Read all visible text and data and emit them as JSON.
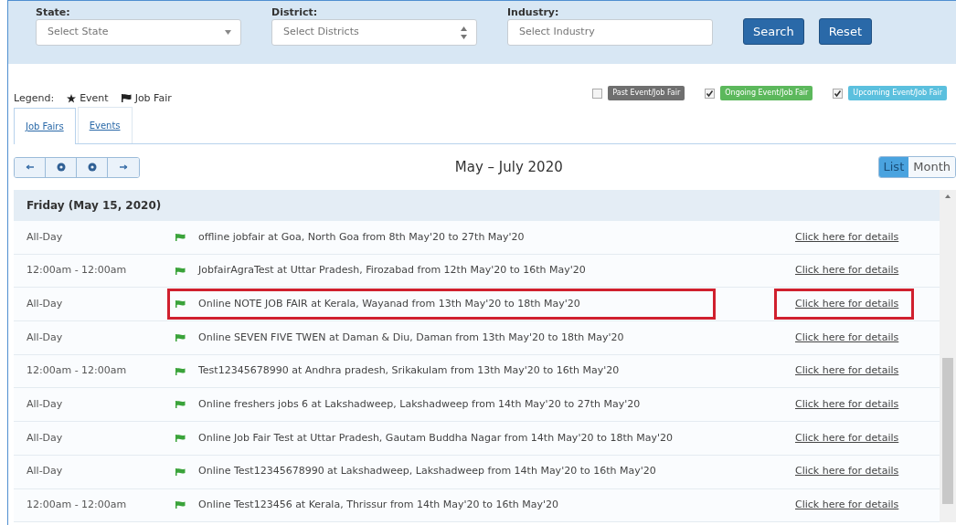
{
  "filters": [
    {
      "label": "State:",
      "kind": "select",
      "placeholder": "Select State"
    },
    {
      "label": "District:",
      "kind": "spinner",
      "placeholder": "Select Districts"
    },
    {
      "label": "Industry:",
      "kind": "text",
      "placeholder": "Select Industry"
    }
  ],
  "filter_buttons": [
    "Search",
    "Reset"
  ],
  "legend": {
    "label": "Legend:",
    "items": [
      {
        "kind": "star",
        "label": "Event"
      },
      {
        "kind": "flag",
        "label": "Job Fair"
      }
    ]
  },
  "status_filters": [
    {
      "label": "Past Event/Job Fair",
      "checked": false,
      "color": "#6f6f6f"
    },
    {
      "label": "Ongoing Event/Job Fair",
      "checked": true,
      "color": "#5cb85c"
    },
    {
      "label": "Upcoming Event/Job Fair",
      "checked": true,
      "color": "#5bc0de"
    }
  ],
  "tabs": [
    {
      "label": "Job Fairs",
      "selected": true
    },
    {
      "label": "Events",
      "selected": false
    }
  ],
  "calendar": {
    "title": "May – July 2020",
    "views": [
      {
        "label": "List",
        "selected": true
      },
      {
        "label": "Month",
        "selected": false
      }
    ],
    "day_header": "Friday (May 15, 2020)",
    "rows": [
      {
        "time": "All-Day",
        "title": "offline jobfair at Goa, North Goa from 8th May'20 to 27th May'20",
        "link": "Click here for details",
        "highlighted": false
      },
      {
        "time": "12:00am - 12:00am",
        "title": "JobfairAgraTest at Uttar Pradesh, Firozabad from 12th May'20 to 16th May'20",
        "link": "Click here for details",
        "highlighted": false
      },
      {
        "time": "All-Day",
        "title": "Online NOTE JOB FAIR at Kerala, Wayanad from 13th May'20 to 18th May'20",
        "link": "Click here for details",
        "highlighted": true
      },
      {
        "time": "All-Day",
        "title": "Online SEVEN FIVE TWEN at Daman & Diu, Daman from 13th May'20 to 18th May'20",
        "link": "Click here for details",
        "highlighted": false
      },
      {
        "time": "12:00am - 12:00am",
        "title": "Test12345678990 at Andhra pradesh, Srikakulam from 13th May'20 to 16th May'20",
        "link": "Click here for details",
        "highlighted": false
      },
      {
        "time": "All-Day",
        "title": "Online freshers jobs 6 at Lakshadweep, Lakshadweep from 14th May'20 to 27th May'20",
        "link": "Click here for details",
        "highlighted": false
      },
      {
        "time": "All-Day",
        "title": "Online Job Fair Test at Uttar Pradesh, Gautam Buddha Nagar from 14th May'20 to 18th May'20",
        "link": "Click here for details",
        "highlighted": false
      },
      {
        "time": "All-Day",
        "title": "Online Test12345678990 at Lakshadweep, Lakshadweep from 14th May'20 to 16th May'20",
        "link": "Click here for details",
        "highlighted": false
      },
      {
        "time": "12:00am - 12:00am",
        "title": "Online Test123456 at Kerala, Thrissur from 14th May'20 to 16th May'20",
        "link": "Click here for details",
        "highlighted": false
      }
    ]
  }
}
